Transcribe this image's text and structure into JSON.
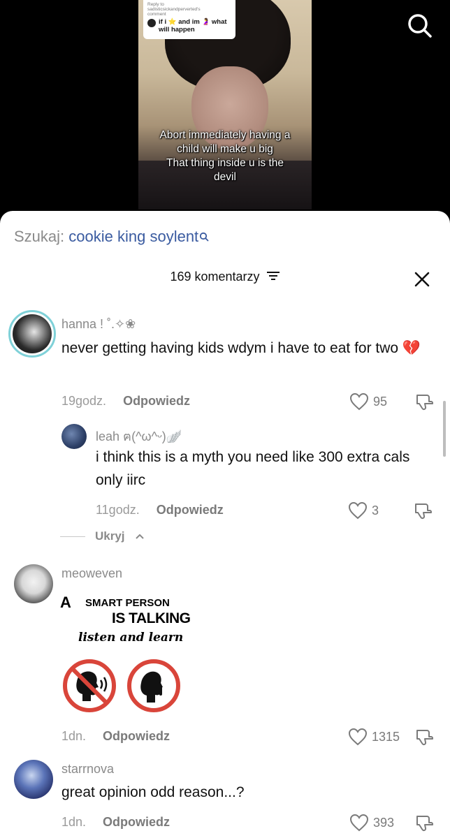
{
  "video": {
    "reply_sticker": {
      "line1": "Reply to",
      "line2": "sadisticsickandperverted's",
      "line3": "comment",
      "body": "if i ⭐ and im 🤰 what will happen"
    },
    "caption": [
      "Abort immediately having a",
      "child will make u big",
      "That thing inside u is the",
      "devil"
    ]
  },
  "search": {
    "label": "Szukaj:",
    "query": "cookie king soylent"
  },
  "header": {
    "count_label": "169 komentarzy"
  },
  "comments": [
    {
      "username": "hanna ! ˚.✧❀",
      "text": "never getting having kids wdym i have to eat for two 💔",
      "time": "19godz.",
      "reply_label": "Odpowiedz",
      "likes": "95"
    },
    {
      "username": "leah ฅ(^ω^ᵕ)🪽",
      "text": "i think this is a myth you need like 300 extra cals only iirc",
      "time": "11godz.",
      "reply_label": "Odpowiedz",
      "likes": "3"
    },
    {
      "username": "meoweven",
      "time": "1dn.",
      "reply_label": "Odpowiedz",
      "likes": "1315",
      "meme": {
        "letter": "A",
        "line1": "SMART PERSON",
        "line2": "IS TALKING",
        "line3": "listen and learn"
      }
    },
    {
      "username": "starrnova",
      "text": "great opinion odd reason...?",
      "time": "1dn.",
      "reply_label": "Odpowiedz",
      "likes": "393"
    }
  ],
  "hide_replies_label": "Ukryj",
  "colors": {
    "accent_link": "#3a5ba0",
    "muted_text": "#8a8a8a",
    "sheet_bg": "#ffffff",
    "no_sign_red": "#d9453a"
  }
}
